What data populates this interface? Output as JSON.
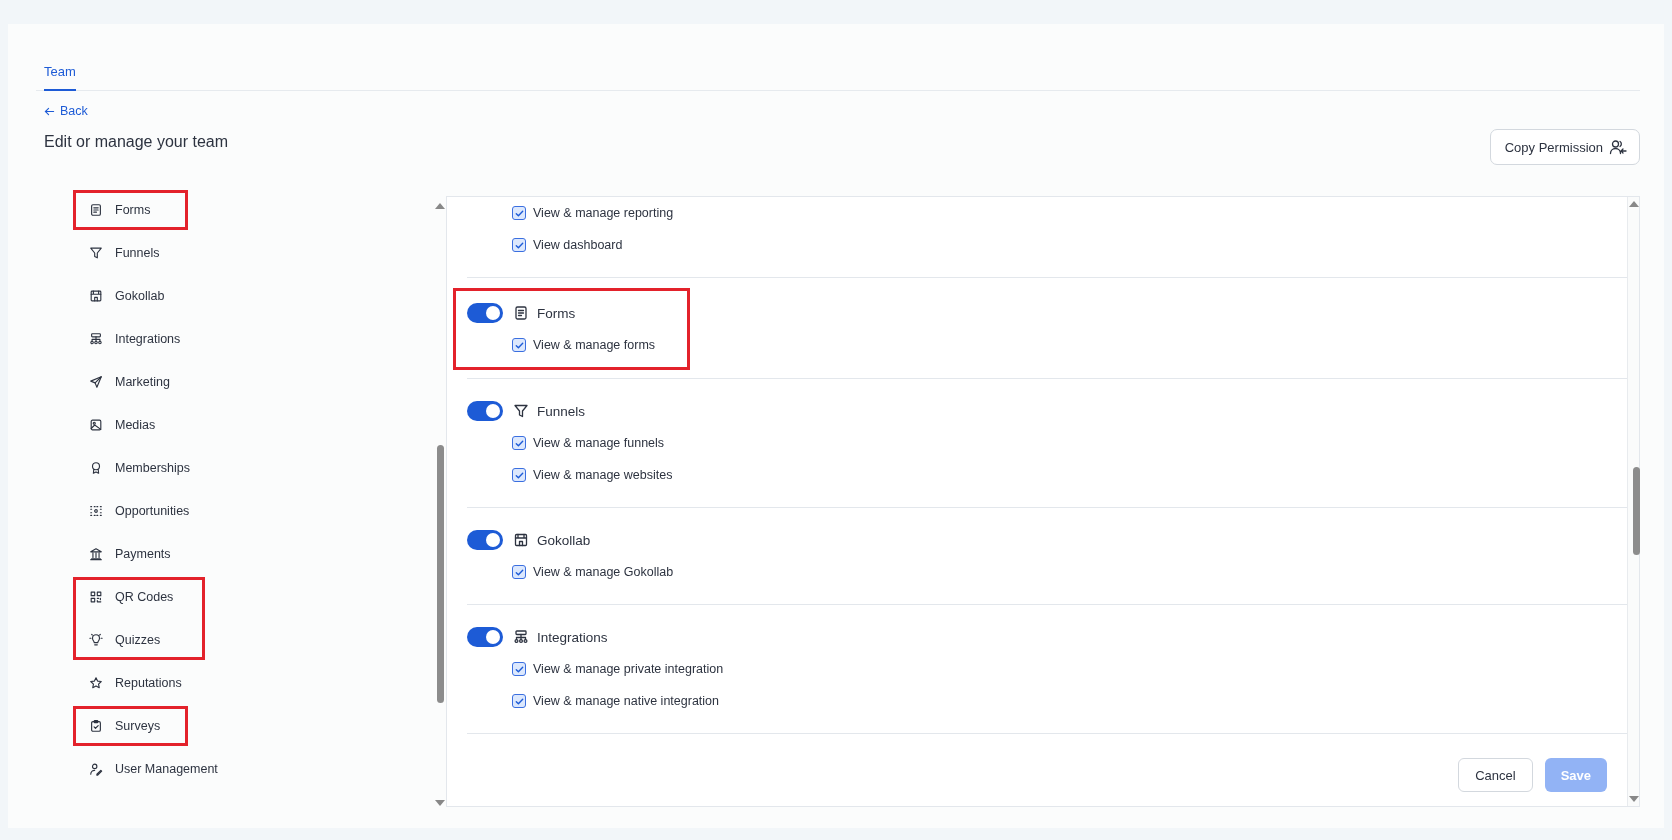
{
  "tabs": [
    {
      "label": "Team",
      "selected": true
    }
  ],
  "back_link": "Back",
  "title": "Edit or manage your team",
  "copy_button": "Copy Permission",
  "sidebar": {
    "items": [
      {
        "label": "Forms",
        "highlighted": true
      },
      {
        "label": "Funnels",
        "highlighted": false
      },
      {
        "label": "Gokollab",
        "highlighted": false
      },
      {
        "label": "Integrations",
        "highlighted": false
      },
      {
        "label": "Marketing",
        "highlighted": false
      },
      {
        "label": "Medias",
        "highlighted": false
      },
      {
        "label": "Memberships",
        "highlighted": false
      },
      {
        "label": "Opportunities",
        "highlighted": false
      },
      {
        "label": "Payments",
        "highlighted": false
      },
      {
        "label": "QR Codes",
        "highlighted": true
      },
      {
        "label": "Quizzes",
        "highlighted": true
      },
      {
        "label": "Reputations",
        "highlighted": false
      },
      {
        "label": "Surveys",
        "highlighted": true
      },
      {
        "label": "User Management",
        "highlighted": false
      }
    ]
  },
  "sections": [
    {
      "highlighted": false,
      "permissions": [
        {
          "label": "View & manage reporting",
          "checked": true
        },
        {
          "label": "View dashboard",
          "checked": true
        }
      ]
    },
    {
      "title": "Forms",
      "on": true,
      "highlighted": true,
      "permissions": [
        {
          "label": "View & manage forms",
          "checked": true
        }
      ]
    },
    {
      "title": "Funnels",
      "on": true,
      "highlighted": false,
      "permissions": [
        {
          "label": "View & manage funnels",
          "checked": true
        },
        {
          "label": "View & manage websites",
          "checked": true
        }
      ]
    },
    {
      "title": "Gokollab",
      "on": true,
      "highlighted": false,
      "permissions": [
        {
          "label": "View & manage Gokollab",
          "checked": true
        }
      ]
    },
    {
      "title": "Integrations",
      "on": true,
      "highlighted": false,
      "permissions": [
        {
          "label": "View & manage private integration",
          "checked": true
        },
        {
          "label": "View & manage native integration",
          "checked": true
        }
      ]
    }
  ],
  "footer": {
    "cancel": "Cancel",
    "save": "Save",
    "save_disabled": true
  }
}
